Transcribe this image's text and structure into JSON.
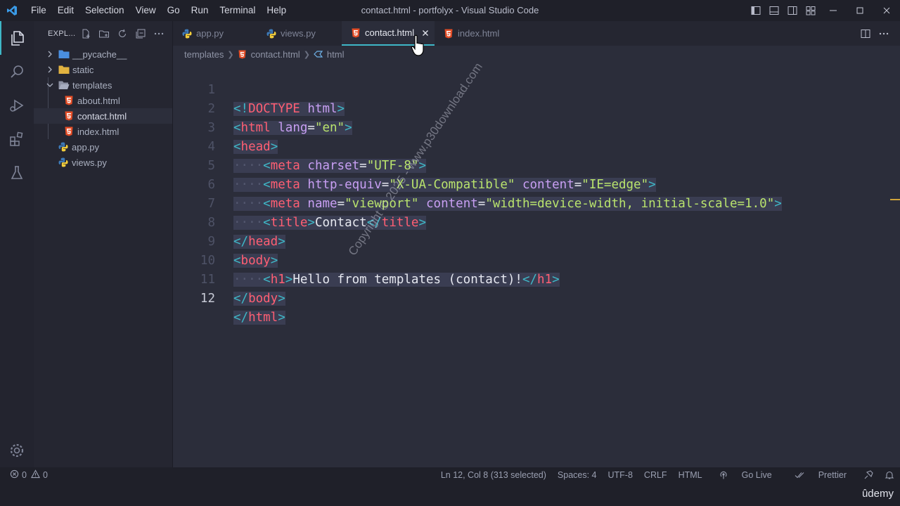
{
  "titlebar": {
    "menu": [
      "File",
      "Edit",
      "Selection",
      "View",
      "Go",
      "Run",
      "Terminal",
      "Help"
    ],
    "title": "contact.html - portfolyx - Visual Studio Code"
  },
  "sidebar": {
    "header": "EXPL...",
    "items": [
      {
        "label": "__pycache__",
        "type": "folder",
        "expanded": false
      },
      {
        "label": "static",
        "type": "folder",
        "expanded": false
      },
      {
        "label": "templates",
        "type": "folder",
        "expanded": true
      },
      {
        "label": "about.html",
        "type": "html"
      },
      {
        "label": "contact.html",
        "type": "html",
        "selected": true
      },
      {
        "label": "index.html",
        "type": "html"
      },
      {
        "label": "app.py",
        "type": "python"
      },
      {
        "label": "views.py",
        "type": "python"
      }
    ]
  },
  "tabs": [
    {
      "label": "app.py",
      "icon": "python-icon"
    },
    {
      "label": "views.py",
      "icon": "python-icon"
    },
    {
      "label": "contact.html",
      "icon": "html5-icon",
      "active": true
    },
    {
      "label": "index.html",
      "icon": "html5-icon"
    }
  ],
  "breadcrumb": [
    "templates",
    "contact.html",
    "html"
  ],
  "editor": {
    "lines": [
      {
        "n": "1",
        "code": "<!DOCTYPE html>"
      },
      {
        "n": "2",
        "code": "<html lang=\"en\">"
      },
      {
        "n": "3",
        "code": "<head>"
      },
      {
        "n": "4",
        "code": "    <meta charset=\"UTF-8\">"
      },
      {
        "n": "5",
        "code": "    <meta http-equiv=\"X-UA-Compatible\" content=\"IE=edge\">"
      },
      {
        "n": "6",
        "code": "    <meta name=\"viewport\" content=\"width=device-width, initial-scale=1.0\">"
      },
      {
        "n": "7",
        "code": "    <title>Contact</title>"
      },
      {
        "n": "8",
        "code": "</head>"
      },
      {
        "n": "9",
        "code": "<body>"
      },
      {
        "n": "10",
        "code": "    <h1>Hello from templates (contact)!</h1>"
      },
      {
        "n": "11",
        "code": "</body>"
      },
      {
        "n": "12",
        "code": "</html>"
      }
    ],
    "watermark": "Copyright © 2025 - www.p30download.com"
  },
  "statusbar": {
    "errors": "0",
    "warnings": "0",
    "position": "Ln 12, Col 8 (313 selected)",
    "spaces": "Spaces: 4",
    "encoding": "UTF-8",
    "eol": "CRLF",
    "language": "HTML",
    "golive": "Go Live",
    "prettier": "Prettier"
  },
  "brand": "ûdemy",
  "colors": {
    "accent": "#3fb7c7",
    "tag": "#ff5f73",
    "attribute": "#c89ff3",
    "string": "#b9e36d",
    "html_icon": "#e44d26",
    "folder": "#e2b340",
    "python_blue": "#3d7ab8",
    "python_yellow": "#f2cd3c"
  }
}
